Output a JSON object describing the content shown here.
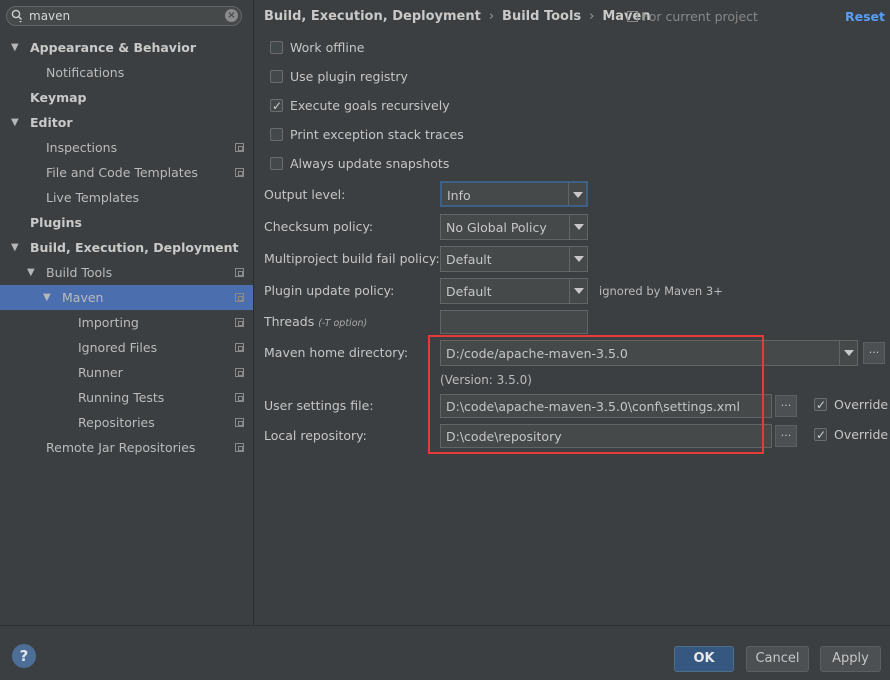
{
  "search": {
    "value": "maven"
  },
  "sidebar": {
    "items": [
      {
        "label": "Appearance & Behavior",
        "bold": true,
        "level": 0,
        "expanded": true,
        "project": false
      },
      {
        "label": "Notifications",
        "bold": false,
        "level": 1,
        "project": false
      },
      {
        "label": "Keymap",
        "bold": true,
        "level": 0,
        "project": false
      },
      {
        "label": "Editor",
        "bold": true,
        "level": 0,
        "expanded": true,
        "project": false
      },
      {
        "label": "Inspections",
        "bold": false,
        "level": 1,
        "project": true
      },
      {
        "label": "File and Code Templates",
        "bold": false,
        "level": 1,
        "project": true
      },
      {
        "label": "Live Templates",
        "bold": false,
        "level": 1,
        "project": false
      },
      {
        "label": "Plugins",
        "bold": true,
        "level": 0,
        "project": false
      },
      {
        "label": "Build, Execution, Deployment",
        "bold": true,
        "level": 0,
        "expanded": true,
        "project": false
      },
      {
        "label": "Build Tools",
        "bold": false,
        "level": 1,
        "expanded": true,
        "project": true
      },
      {
        "label": "Maven",
        "bold": false,
        "level": 2,
        "expanded": true,
        "project": true,
        "selected": true
      },
      {
        "label": "Importing",
        "bold": false,
        "level": 3,
        "project": true
      },
      {
        "label": "Ignored Files",
        "bold": false,
        "level": 3,
        "project": true
      },
      {
        "label": "Runner",
        "bold": false,
        "level": 3,
        "project": true
      },
      {
        "label": "Running Tests",
        "bold": false,
        "level": 3,
        "project": true
      },
      {
        "label": "Repositories",
        "bold": false,
        "level": 3,
        "project": true
      },
      {
        "label": "Remote Jar Repositories",
        "bold": false,
        "level": 1,
        "project": true
      }
    ]
  },
  "breadcrumb": {
    "items": [
      "Build, Execution, Deployment",
      "Build Tools",
      "Maven"
    ]
  },
  "scope": "For current project",
  "reset": "Reset",
  "checkboxes": [
    {
      "label": "Work offline",
      "checked": false
    },
    {
      "label": "Use plugin registry",
      "checked": false
    },
    {
      "label": "Execute goals recursively",
      "checked": true
    },
    {
      "label": "Print exception stack traces",
      "checked": false
    },
    {
      "label": "Always update snapshots",
      "checked": false
    }
  ],
  "form": {
    "output_level": {
      "label": "Output level:",
      "value": "Info"
    },
    "checksum": {
      "label": "Checksum policy:",
      "value": "No Global Policy"
    },
    "fail_policy": {
      "label": "Multiproject build fail policy:",
      "value": "Default"
    },
    "plugin_update": {
      "label": "Plugin update policy:",
      "value": "Default",
      "note": "ignored by Maven 3+"
    },
    "threads": {
      "label": "Threads",
      "hint": "(-T option)",
      "value": ""
    },
    "maven_home": {
      "label": "Maven home directory:",
      "value": "D:/code/apache-maven-3.5.0",
      "version": "(Version: 3.5.0)"
    },
    "user_settings": {
      "label": "User settings file:",
      "value": "D:\\code\\apache-maven-3.5.0\\conf\\settings.xml",
      "override_label": "Override",
      "override": true
    },
    "local_repo": {
      "label": "Local repository:",
      "value": "D:\\code\\repository",
      "override_label": "Override",
      "override": true
    },
    "browse_label": "..."
  },
  "footer": {
    "help": "?",
    "ok": "OK",
    "cancel": "Cancel",
    "apply": "Apply"
  },
  "colors": {
    "accent": "#4b6eaf",
    "highlight_box": "#e63a3a",
    "link": "#589df6"
  }
}
